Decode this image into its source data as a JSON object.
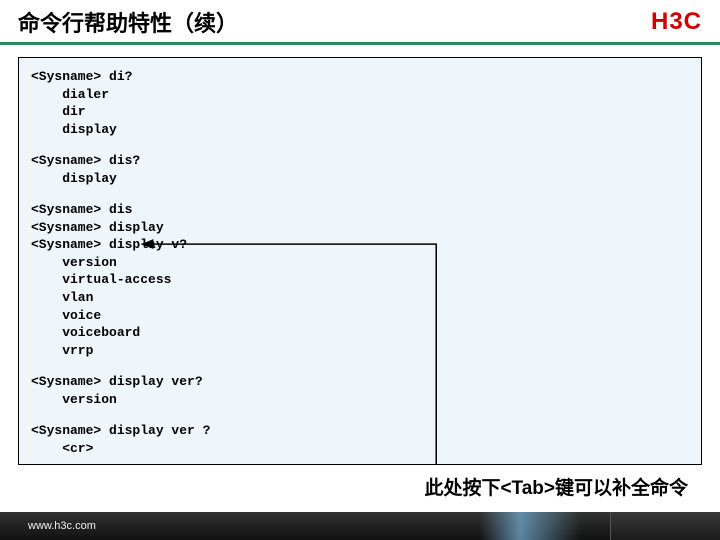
{
  "header": {
    "title": "命令行帮助特性（续）",
    "logo": "H3C"
  },
  "terminal": {
    "b1": "<Sysname> di?\n    dialer\n    dir\n    display",
    "b2": "<Sysname> dis?\n    display",
    "b3": "<Sysname> dis\n<Sysname> display\n<Sysname> display v?\n    version\n    virtual-access\n    vlan\n    voice\n    voiceboard\n    vrrp",
    "b4": "<Sysname> display ver?\n    version",
    "b5": "<Sysname> display ver ?\n    <cr>"
  },
  "note": "此处按下<Tab>键可以补全命令",
  "footer": {
    "url": "www.h3c.com"
  }
}
